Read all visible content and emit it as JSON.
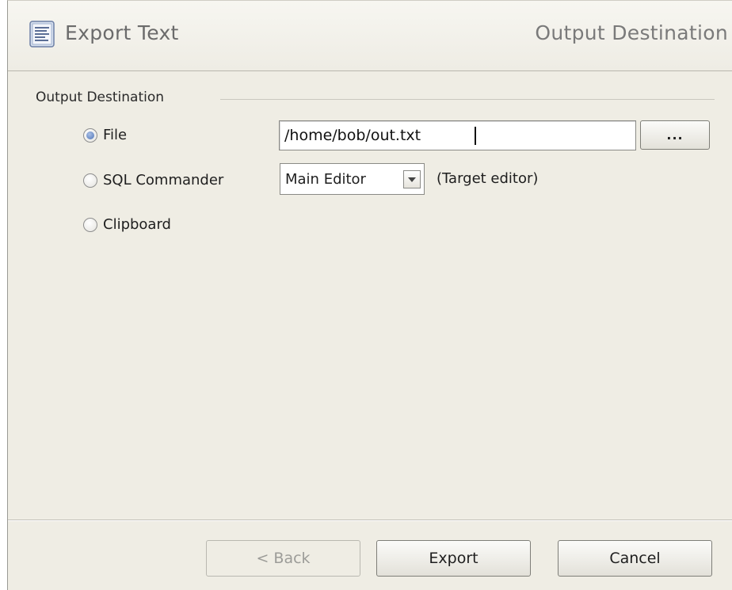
{
  "header": {
    "title": "Export Text",
    "step": "Output Destination",
    "icon": "document-text-icon"
  },
  "group": {
    "title": "Output Destination"
  },
  "options": {
    "file": {
      "label": "File",
      "checked": true,
      "path": "/home/bob/out.txt",
      "browse_label": "..."
    },
    "sql_commander": {
      "label": "SQL Commander",
      "checked": false,
      "editor_selected": "Main Editor",
      "note": "(Target editor)"
    },
    "clipboard": {
      "label": "Clipboard",
      "checked": false
    }
  },
  "footer": {
    "back_label": "< Back",
    "back_enabled": false,
    "export_label": "Export",
    "cancel_label": "Cancel"
  },
  "colors": {
    "dialog_bg": "#efede4",
    "radio_selected": "#5074b6",
    "header_text": "#6b6b6b"
  }
}
